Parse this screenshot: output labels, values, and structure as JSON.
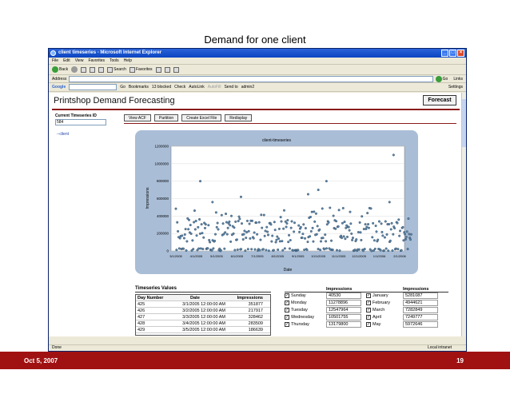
{
  "slide": {
    "title": "Demand for one client",
    "date": "Oct 5, 2007",
    "page": "19"
  },
  "window": {
    "title": "client timeseries - Microsoft Internet Explorer"
  },
  "menu": [
    "File",
    "Edit",
    "View",
    "Favorites",
    "Tools",
    "Help"
  ],
  "toolbar": {
    "back": "Back",
    "search": "Search",
    "favorites": "Favorites"
  },
  "addressbar": {
    "label": "Address",
    "go": "Go",
    "links": "Links"
  },
  "googlebar": {
    "logo": "Google",
    "go": "Go",
    "bookmarks": "Bookmarks",
    "blocked": "13 blocked",
    "check": "Check",
    "autolink": "AutoLink",
    "autofill": "AutoFill",
    "sendto": "Send to",
    "user": "admin2",
    "settings": "Settings"
  },
  "app": {
    "title": "Printshop Demand Forecasting",
    "forecast_button": "Forecast",
    "timeseries_label": "Current Timeseries ID",
    "timeseries_id": "584",
    "tree_item": "--client",
    "buttons": [
      "View ACF",
      "Partition",
      "Create Excel File",
      "Redisplay"
    ]
  },
  "chart_data": {
    "type": "scatter",
    "title": "client-timeseries",
    "xlabel": "Date",
    "ylabel": "Impressions",
    "ylim": [
      0,
      1200000
    ],
    "yticks": [
      "0",
      "200000",
      "400000",
      "600000",
      "800000",
      "1000000",
      "1200000"
    ],
    "xticks": [
      "3/1/2005",
      "4/1/2005",
      "5/1/2005",
      "6/1/2005",
      "7/1/2005",
      "8/1/2005",
      "9/1/2005",
      "10/1/2005",
      "11/1/2005",
      "12/1/2005",
      "1/1/2006",
      "2/1/2006"
    ],
    "series": [
      {
        "highlights": [
          {
            "x": 1.2,
            "y": 800000
          },
          {
            "x": 3.2,
            "y": 620000
          },
          {
            "x": 6.5,
            "y": 650000
          },
          {
            "x": 7.0,
            "y": 700000
          },
          {
            "x": 7.4,
            "y": 800000
          },
          {
            "x": 10.5,
            "y": 560000
          },
          {
            "x": 10.7,
            "y": 1100000
          },
          {
            "x": 1.8,
            "y": 560000
          }
        ]
      }
    ]
  },
  "timeseries_table": {
    "title": "Timeseries Values",
    "headers": [
      "Day Number",
      "Date",
      "Impressions"
    ],
    "rows": [
      [
        "425",
        "3/1/2005 12:00:00 AM",
        "351877"
      ],
      [
        "426",
        "3/2/2005 12:00:00 AM",
        "217917"
      ],
      [
        "427",
        "3/3/2005 12:00:00 AM",
        "328462"
      ],
      [
        "428",
        "3/4/2005 12:00:00 AM",
        "283509"
      ],
      [
        "429",
        "3/5/2005 12:00:00 AM",
        "186639"
      ]
    ]
  },
  "weekday_table": {
    "header": "Impressions",
    "rows": [
      {
        "day": "Sunday",
        "value": "40530"
      },
      {
        "day": "Monday",
        "value": "11278896"
      },
      {
        "day": "Tuesday",
        "value": "12547964"
      },
      {
        "day": "Wednesday",
        "value": "10501755"
      },
      {
        "day": "Thursday",
        "value": "13179800"
      }
    ]
  },
  "month_table": {
    "header": "Impressions",
    "rows": [
      {
        "month": "January",
        "value": "5281087"
      },
      {
        "month": "February",
        "value": "4944621"
      },
      {
        "month": "March",
        "value": "7282849"
      },
      {
        "month": "April",
        "value": "7249777"
      },
      {
        "month": "May",
        "value": "5972646"
      }
    ]
  },
  "status": {
    "left": "Done",
    "right": "Local intranet"
  }
}
